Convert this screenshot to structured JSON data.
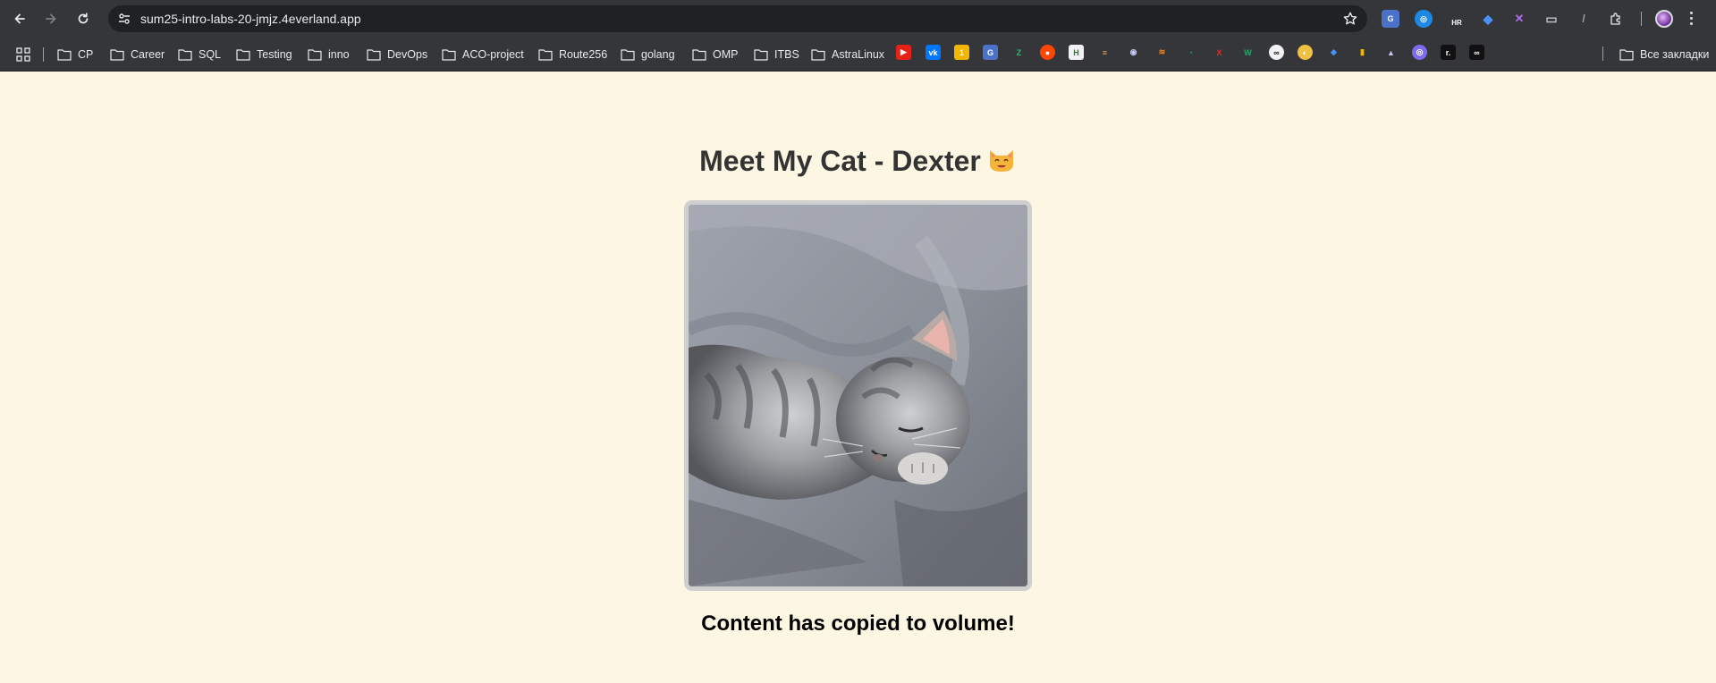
{
  "browser": {
    "url": "sum25-intro-labs-20-jmjz.4everland.app",
    "bookmarks": [
      "CP",
      "Career",
      "SQL",
      "Testing",
      "inno",
      "DevOps",
      "ACO-project",
      "Route256",
      "golang",
      "OMP",
      "ITBS",
      "AstraLinux"
    ],
    "all_bookmarks_label": "Все закладки",
    "extension_badge": "HR"
  },
  "page": {
    "title": "Meet My Cat - Dexter",
    "title_emoji": "cat-face-icon",
    "image_subject": "sleeping kitten photo",
    "status_message": "Content has copied to volume!"
  },
  "colors": {
    "page_background": "#fdf6e3",
    "title_text": "#333333",
    "chrome_background": "#35363a",
    "omnibox_background": "#202124",
    "frame_border": "#cfcfcf"
  }
}
